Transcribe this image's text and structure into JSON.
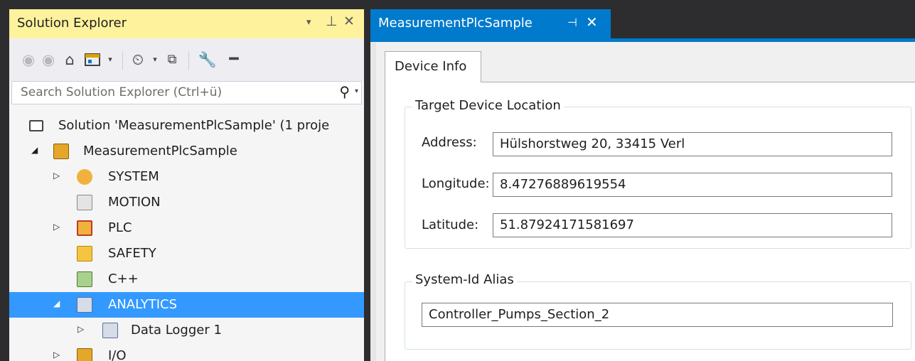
{
  "solution_explorer": {
    "title": "Solution Explorer",
    "controls": {
      "dropdown": "▾",
      "pin": "⊥",
      "close": "✕"
    },
    "search": {
      "placeholder": "Search Solution Explorer (Ctrl+ü)"
    },
    "tree": [
      {
        "label": "Solution 'MeasurementPlcSample' (1 proje",
        "icon": "solution-icon"
      },
      {
        "label": "MeasurementPlcSample",
        "icon": "project-icon",
        "expanded": true
      },
      {
        "label": "SYSTEM",
        "icon": "system-icon",
        "expanded": false
      },
      {
        "label": "MOTION",
        "icon": "motion-icon"
      },
      {
        "label": "PLC",
        "icon": "plc-icon",
        "expanded": false
      },
      {
        "label": "SAFETY",
        "icon": "safety-icon"
      },
      {
        "label": "C++",
        "icon": "cpp-icon"
      },
      {
        "label": "ANALYTICS",
        "icon": "analytics-icon",
        "expanded": true,
        "selected": true
      },
      {
        "label": "Data Logger 1",
        "icon": "data-logger-icon",
        "expanded": false
      },
      {
        "label": "I/O",
        "icon": "io-icon",
        "expanded": false
      }
    ]
  },
  "document": {
    "tab_title": "MeasurementPlcSample",
    "tab_pin": "⊣",
    "tab_close": "✕",
    "inner_tab": "Device Info",
    "target_location": {
      "title": "Target Device Location",
      "address_label": "Address:",
      "address_value": "Hülshorstweg 20, 33415 Verl",
      "longitude_label": "Longitude:",
      "longitude_value": "8.47276889619554",
      "latitude_label": "Latitude:",
      "latitude_value": "51.87924171581697"
    },
    "system_id": {
      "title": "System-Id Alias",
      "value": "Controller_Pumps_Section_2"
    }
  },
  "colors": {
    "title_highlight": "#fff29d",
    "accent": "#007acc",
    "selection": "#3399ff",
    "frame": "#2d2d30"
  }
}
